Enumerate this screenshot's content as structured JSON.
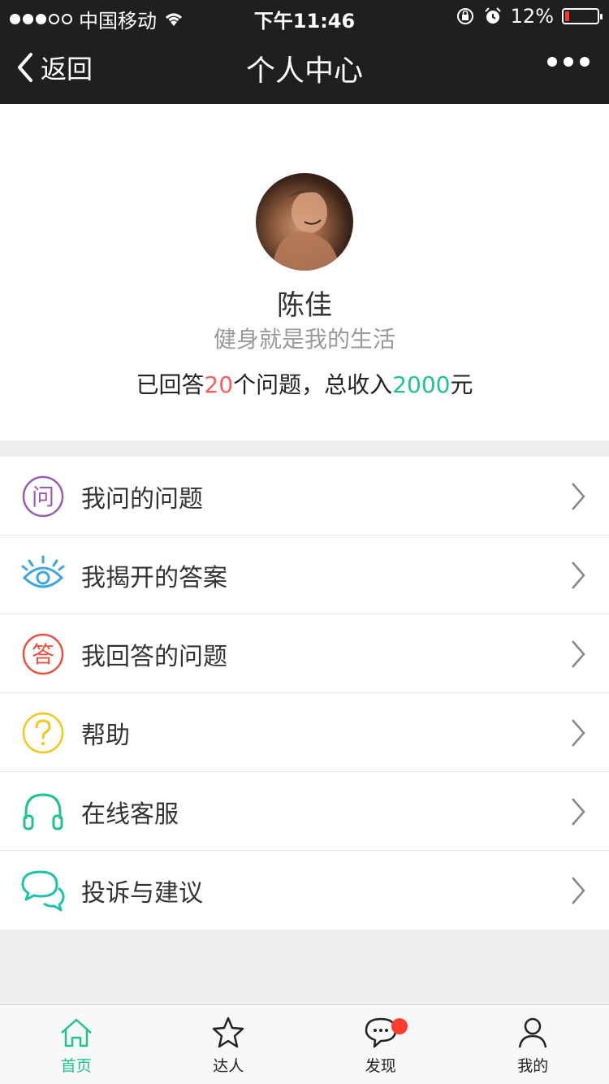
{
  "status_bar": {
    "carrier": "中国移动",
    "time": "下午11:46",
    "battery": "12%"
  },
  "nav": {
    "back_label": "返回",
    "title": "个人中心"
  },
  "profile": {
    "name": "陈佳",
    "motto": "健身就是我的生活",
    "stats_prefix": "已回答",
    "answered_count": "20",
    "stats_middle": "个问题，总收入",
    "total_income": "2000",
    "stats_suffix": "元"
  },
  "menu": [
    {
      "label": "我问的问题",
      "icon": "question-mark-wen-icon",
      "color": "#9b59b6"
    },
    {
      "label": "我揭开的答案",
      "icon": "eye-icon",
      "color": "#3ea6e0"
    },
    {
      "label": "我回答的问题",
      "icon": "answer-da-icon",
      "color": "#e8523f"
    },
    {
      "label": "帮助",
      "icon": "help-icon",
      "color": "#f5c518"
    },
    {
      "label": "在线客服",
      "icon": "headset-icon",
      "color": "#1fc48a"
    },
    {
      "label": "投诉与建议",
      "icon": "chat-bubbles-icon",
      "color": "#1fc4a8"
    }
  ],
  "icon_glyphs": {
    "wen": "问",
    "da": "答"
  },
  "tabbar": [
    {
      "label": "首页",
      "icon": "home-icon",
      "active": true
    },
    {
      "label": "达人",
      "icon": "star-icon",
      "active": false
    },
    {
      "label": "发现",
      "icon": "chat-icon",
      "active": false
    },
    {
      "label": "我的",
      "icon": "user-icon",
      "active": false
    }
  ],
  "colors": {
    "accent": "#1fc48a",
    "highlight_red": "#ff5c5c",
    "nav_bg": "#1f1f1f"
  }
}
